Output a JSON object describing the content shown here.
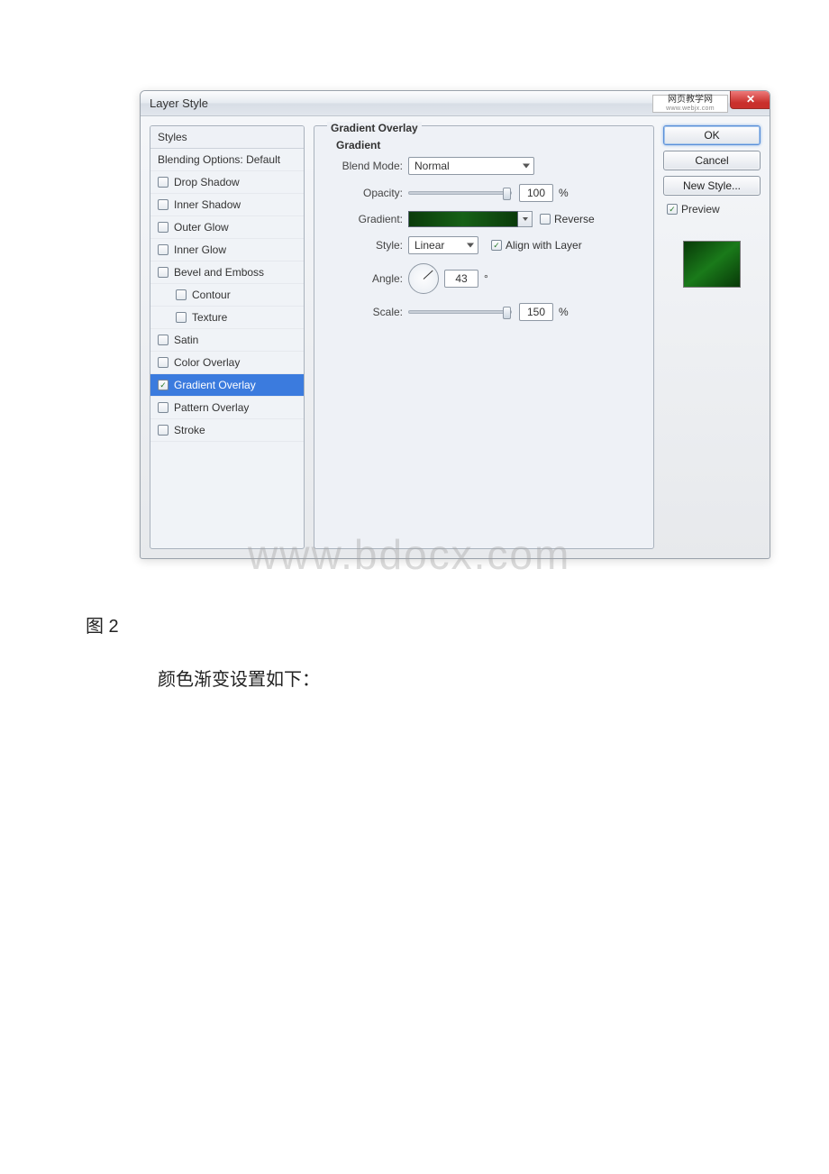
{
  "window": {
    "title": "Layer Style",
    "watermark_label": "网页教学网",
    "watermark_sub": "www.webjx.com",
    "close_glyph": "✕"
  },
  "styles": {
    "header": "Styles",
    "blending": "Blending Options: Default",
    "items": [
      {
        "label": "Drop Shadow",
        "checked": false,
        "sub": false,
        "selected": false
      },
      {
        "label": "Inner Shadow",
        "checked": false,
        "sub": false,
        "selected": false
      },
      {
        "label": "Outer Glow",
        "checked": false,
        "sub": false,
        "selected": false
      },
      {
        "label": "Inner Glow",
        "checked": false,
        "sub": false,
        "selected": false
      },
      {
        "label": "Bevel and Emboss",
        "checked": false,
        "sub": false,
        "selected": false
      },
      {
        "label": "Contour",
        "checked": false,
        "sub": true,
        "selected": false
      },
      {
        "label": "Texture",
        "checked": false,
        "sub": true,
        "selected": false
      },
      {
        "label": "Satin",
        "checked": false,
        "sub": false,
        "selected": false
      },
      {
        "label": "Color Overlay",
        "checked": false,
        "sub": false,
        "selected": false
      },
      {
        "label": "Gradient Overlay",
        "checked": true,
        "sub": false,
        "selected": true
      },
      {
        "label": "Pattern Overlay",
        "checked": false,
        "sub": false,
        "selected": false
      },
      {
        "label": "Stroke",
        "checked": false,
        "sub": false,
        "selected": false
      }
    ]
  },
  "settings": {
    "group_title": "Gradient Overlay",
    "sub_title": "Gradient",
    "blend_mode_label": "Blend Mode:",
    "blend_mode_value": "Normal",
    "opacity_label": "Opacity:",
    "opacity_value": "100",
    "opacity_unit": "%",
    "gradient_label": "Gradient:",
    "reverse_label": "Reverse",
    "reverse_checked": false,
    "style_label": "Style:",
    "style_value": "Linear",
    "align_label": "Align with Layer",
    "align_checked": true,
    "angle_label": "Angle:",
    "angle_value": "43",
    "angle_unit": "°",
    "scale_label": "Scale:",
    "scale_value": "150",
    "scale_unit": "%"
  },
  "buttons": {
    "ok": "OK",
    "cancel": "Cancel",
    "new_style": "New Style...",
    "preview": "Preview"
  },
  "document": {
    "big_watermark": "www.bdocx.com",
    "caption": "图 2",
    "body": "颜色渐变设置如下："
  }
}
